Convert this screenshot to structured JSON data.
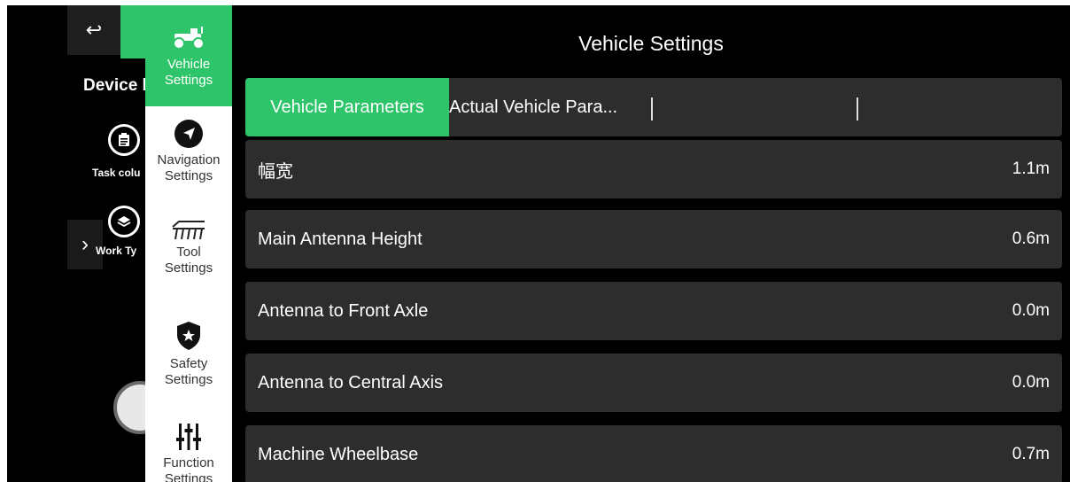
{
  "background": {
    "back_glyph": "↩",
    "device_title": "Device l",
    "task_label": "Task colu",
    "work_label": "Work Ty",
    "expand_glyph": "›",
    "icons": [
      "clipboard-icon",
      "layers-icon",
      "steering-wheel-icon"
    ]
  },
  "menu": {
    "items": [
      {
        "label_line1": "Vehicle",
        "label_line2": "Settings",
        "icon": "tractor-icon",
        "active": true
      },
      {
        "label_line1": "Navigation",
        "label_line2": "Settings",
        "icon": "navigation-arrow-icon",
        "active": false
      },
      {
        "label_line1": "Tool",
        "label_line2": "Settings",
        "icon": "implement-tool-icon",
        "active": false
      },
      {
        "label_line1": "Safety",
        "label_line2": "Settings",
        "icon": "shield-star-icon",
        "active": false
      },
      {
        "label_line1": "Function",
        "label_line2": "Settings",
        "icon": "sliders-icon",
        "active": false
      }
    ]
  },
  "header": {
    "title": "Vehicle Settings"
  },
  "tabs": [
    {
      "label": "Vehicle Parameters",
      "active": true
    },
    {
      "label": "Actual Vehicle Para...",
      "active": false
    }
  ],
  "rows": [
    {
      "label": "幅宽",
      "value": "1.1m"
    },
    {
      "label": "Main Antenna Height",
      "value": "0.6m"
    },
    {
      "label": "Antenna to Front Axle",
      "value": "0.0m"
    },
    {
      "label": "Antenna to Central Axis",
      "value": "0.0m"
    },
    {
      "label": "Machine Wheelbase",
      "value": "0.7m"
    }
  ],
  "colors": {
    "accent": "#2ec56a",
    "panel": "#2d2d2d",
    "background": "#000000"
  }
}
